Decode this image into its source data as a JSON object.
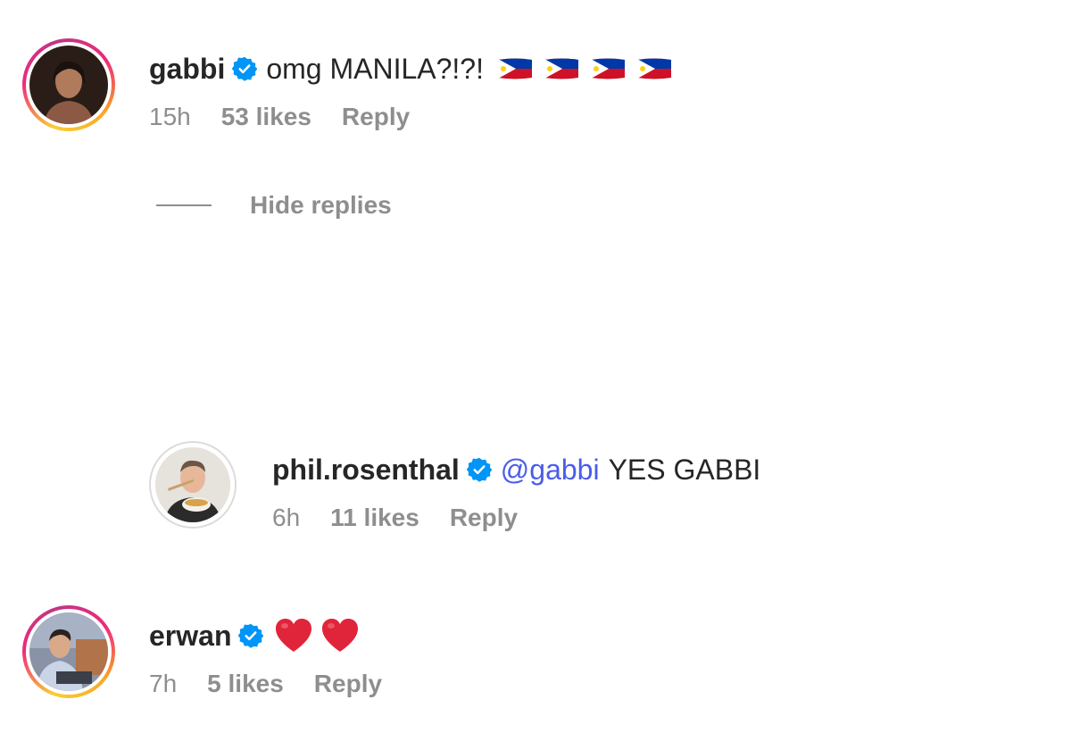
{
  "comments": [
    {
      "username": "gabbi",
      "text": "omg MANILA?!?!",
      "emoji": [
        "philippines-flag",
        "philippines-flag",
        "philippines-flag",
        "philippines-flag"
      ],
      "time": "15h",
      "likes": "53 likes",
      "reply": "Reply",
      "verified": true
    },
    {
      "username": "phil.rosenthal",
      "mention": "@gabbi",
      "text": "YES GABBI",
      "time": "6h",
      "likes": "11 likes",
      "reply": "Reply",
      "verified": true
    },
    {
      "username": "erwan",
      "emoji": [
        "red-heart",
        "red-heart"
      ],
      "time": "7h",
      "likes": "5 likes",
      "reply": "Reply",
      "verified": true
    }
  ],
  "hide_replies": "Hide replies",
  "colors": {
    "username": "#262626",
    "meta": "#8e8e8e",
    "mention": "#4a5de8",
    "verified": "#0095f6",
    "heart": "#e0243a"
  }
}
